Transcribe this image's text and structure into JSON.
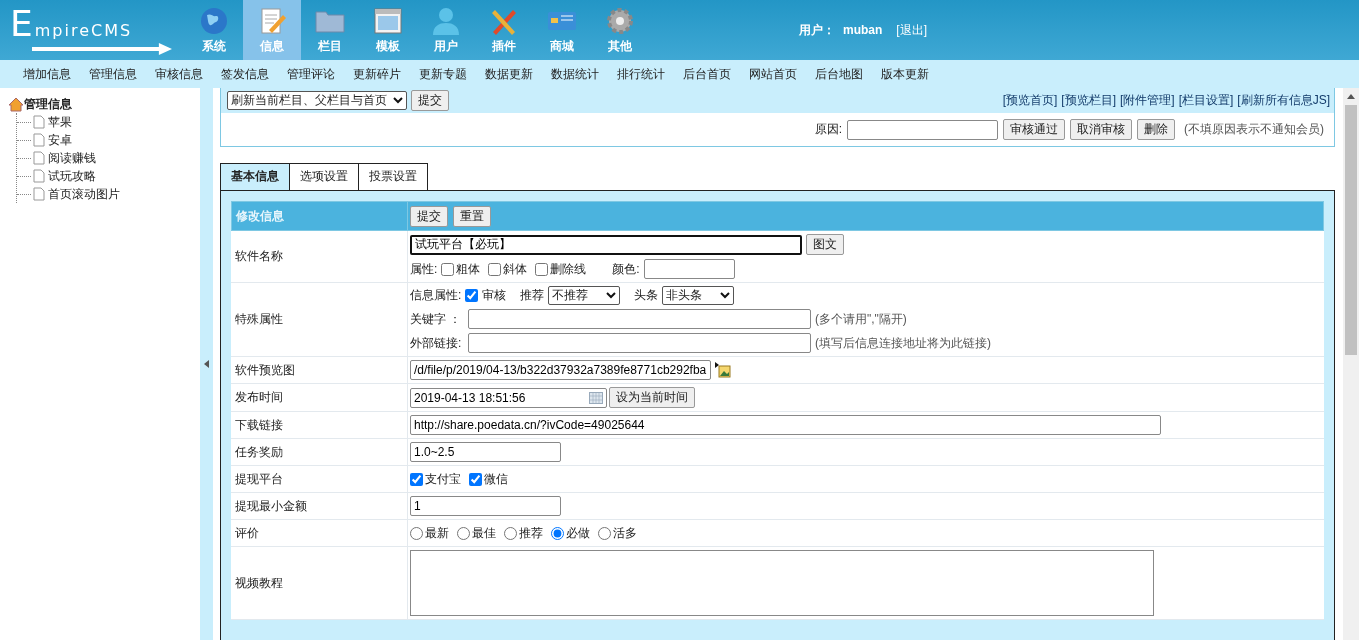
{
  "header": {
    "logo": "EmpireCMS",
    "nav": [
      {
        "label": "系统",
        "selected": false
      },
      {
        "label": "信息",
        "selected": true
      },
      {
        "label": "栏目",
        "selected": false
      },
      {
        "label": "模板",
        "selected": false
      },
      {
        "label": "用户",
        "selected": false
      },
      {
        "label": "插件",
        "selected": false
      },
      {
        "label": "商城",
        "selected": false
      },
      {
        "label": "其他",
        "selected": false
      }
    ],
    "user_label": "用户：",
    "user_name": "muban",
    "logout": "[退出]"
  },
  "submenu": [
    "增加信息",
    "管理信息",
    "审核信息",
    "签发信息",
    "管理评论",
    "更新碎片",
    "更新专题",
    "数据更新",
    "数据统计",
    "排行统计",
    "后台首页",
    "网站首页",
    "后台地图",
    "版本更新"
  ],
  "sidebar": {
    "tree": {
      "label": "管理信息",
      "children": [
        {
          "label": "苹果"
        },
        {
          "label": "安卓"
        },
        {
          "label": "阅读赚钱"
        },
        {
          "label": "试玩攻略"
        },
        {
          "label": "首页滚动图片"
        }
      ]
    }
  },
  "toolbar": {
    "refresh_select": "刷新当前栏目、父栏目与首页",
    "submit": "提交",
    "links": [
      "[预览首页]",
      "[预览栏目]",
      "[附件管理]",
      "[栏目设置]",
      "[刷新所有信息JS]"
    ],
    "reason_label": "原因:",
    "buttons": [
      "审核通过",
      "取消审核",
      "删除"
    ],
    "hint": "(不填原因表示不通知会员)"
  },
  "tabs": [
    {
      "label": "基本信息",
      "selected": true
    },
    {
      "label": "选项设置",
      "selected": false
    },
    {
      "label": "投票设置",
      "selected": false
    }
  ],
  "form": {
    "title": "修改信息",
    "buttons": [
      "提交",
      "重置"
    ],
    "rows": [
      {
        "kind": "title",
        "label": "软件名称",
        "value": "试玩平台【必玩】",
        "button": "图文",
        "attr_label": "属性:",
        "checks": [
          {
            "label": "粗体",
            "checked": false
          },
          {
            "label": "斜体",
            "checked": false
          },
          {
            "label": "删除线",
            "checked": false
          }
        ],
        "color_label": "颜色:"
      },
      {
        "kind": "special",
        "label": "特殊属性",
        "info_label": "信息属性:",
        "check": {
          "label": "审核",
          "checked": true
        },
        "recommend_label": "推荐",
        "recommend_value": "不推荐",
        "head_label": "头条",
        "head_value": "非头条",
        "keyword_label": "关键字 ：",
        "keyword_hint": "(多个请用\",\"隔开)",
        "link_label": "外部链接:",
        "link_hint": "(填写后信息连接地址将为此链接)"
      },
      {
        "kind": "image",
        "label": "软件预览图",
        "value": "/d/file/p/2019/04-13/b322d37932a7389fe8771cb292fba"
      },
      {
        "kind": "datetime",
        "label": "发布时间",
        "value": "2019-04-13 18:51:56",
        "button": "设为当前时间"
      },
      {
        "kind": "long_text",
        "label": "下载链接",
        "value": "http://share.poedata.cn/?ivCode=49025644"
      },
      {
        "kind": "short_text",
        "label": "任务奖励",
        "value": "1.0~2.5"
      },
      {
        "kind": "checks",
        "label": "提现平台",
        "checks": [
          {
            "label": "支付宝",
            "checked": true
          },
          {
            "label": "微信",
            "checked": true
          }
        ]
      },
      {
        "kind": "short_text",
        "label": "提现最小金额",
        "value": "1"
      },
      {
        "kind": "radios",
        "label": "评价",
        "options": [
          {
            "label": "最新",
            "selected": false
          },
          {
            "label": "最佳",
            "selected": false
          },
          {
            "label": "推荐",
            "selected": false
          },
          {
            "label": "必做",
            "selected": true
          },
          {
            "label": "活多",
            "selected": false
          }
        ]
      },
      {
        "kind": "textarea",
        "label": "视频教程"
      }
    ]
  }
}
